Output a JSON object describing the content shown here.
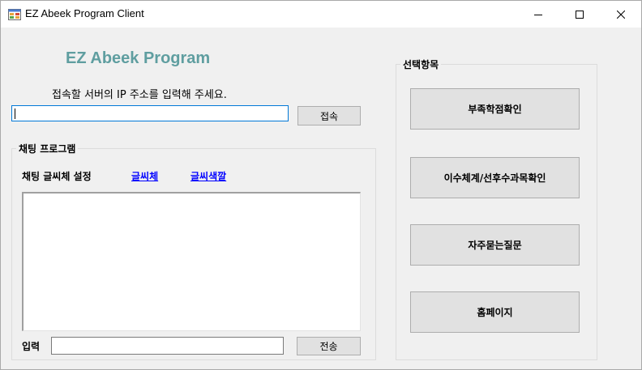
{
  "window": {
    "title": "EZ Abeek Program Client"
  },
  "icons": {
    "app": "app-window-icon",
    "minimize": "minimize-icon",
    "maximize": "maximize-icon",
    "close": "close-icon"
  },
  "main": {
    "heading": "EZ Abeek Program",
    "ip_prompt": "접속할 서버의 IP 주소를 입력해 주세요.",
    "ip_value": "",
    "connect_label": "접속"
  },
  "chat": {
    "group_title": "채팅 프로그램",
    "font_setting_label": "채팅 글씨체 설정",
    "font_link": "글씨체",
    "color_link": "글씨색깔",
    "display_text": "",
    "input_label": "입력",
    "input_value": "",
    "send_label": "전송"
  },
  "selection": {
    "group_title": "선택항목",
    "buttons": [
      {
        "label": "부족학점확인"
      },
      {
        "label": "이수체계/선후수과목확인"
      },
      {
        "label": "자주묻는질문"
      },
      {
        "label": "홈페이지"
      }
    ]
  },
  "colors": {
    "heading": "#5f9ea0",
    "link": "#0000ff",
    "focus_border": "#0078d7",
    "form_background": "#f0f0f0"
  }
}
